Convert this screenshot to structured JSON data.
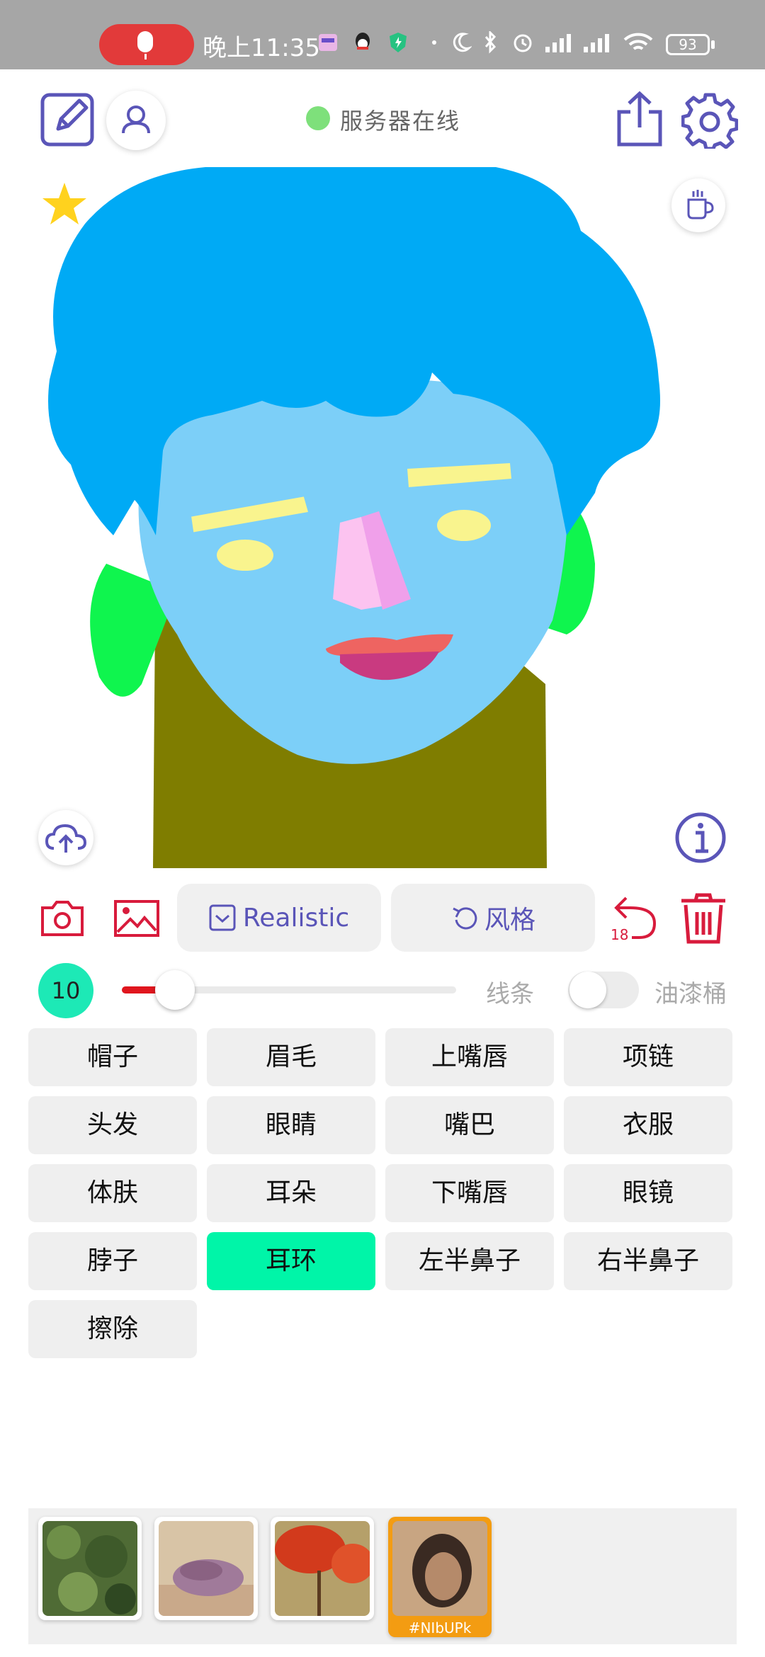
{
  "status_bar": {
    "time": "晚上11:35",
    "battery": "93"
  },
  "header": {
    "server_status": "服务器在线"
  },
  "toolbar": {
    "model_label": "Realistic",
    "style_label": "风格",
    "undo_count": "18"
  },
  "brush": {
    "size": "10",
    "size_fraction": 0.1,
    "line_label": "线条",
    "bucket_label": "油漆桶",
    "bucket_enabled": false
  },
  "parts": [
    {
      "label": "帽子",
      "color": "#efefef"
    },
    {
      "label": "眉毛",
      "color": "#efefef"
    },
    {
      "label": "上嘴唇",
      "color": "#efefef"
    },
    {
      "label": "项链",
      "color": "#efefef"
    },
    {
      "label": "头发",
      "color": "#efefef"
    },
    {
      "label": "眼睛",
      "color": "#efefef"
    },
    {
      "label": "嘴巴",
      "color": "#efefef"
    },
    {
      "label": "衣服",
      "color": "#efefef"
    },
    {
      "label": "体肤",
      "color": "#efefef"
    },
    {
      "label": "耳朵",
      "color": "#efefef"
    },
    {
      "label": "下嘴唇",
      "color": "#efefef"
    },
    {
      "label": "眼镜",
      "color": "#efefef"
    },
    {
      "label": "脖子",
      "color": "#efefef"
    },
    {
      "label": "耳环",
      "color": "#00f5a8"
    },
    {
      "label": "左半鼻子",
      "color": "#efefef"
    },
    {
      "label": "右半鼻子",
      "color": "#efefef"
    },
    {
      "label": "擦除",
      "color": "#efefef"
    }
  ],
  "gallery": {
    "selected_tag": "#NIbUPk"
  },
  "colors": {
    "accent": "#5a55b8",
    "danger": "#d81b3c",
    "active": "#00f5a8",
    "online": "#7ee07b",
    "hair": "#00aaf5",
    "skin": "#7ccff8",
    "ears": "#0ff54e",
    "neck": "#7f7d00",
    "eyes": "#f9f48e",
    "nose_left": "#fcc3f0",
    "nose_right": "#f0a0ea",
    "upper_lip": "#ee6461",
    "lower_lip": "#c93a80"
  }
}
